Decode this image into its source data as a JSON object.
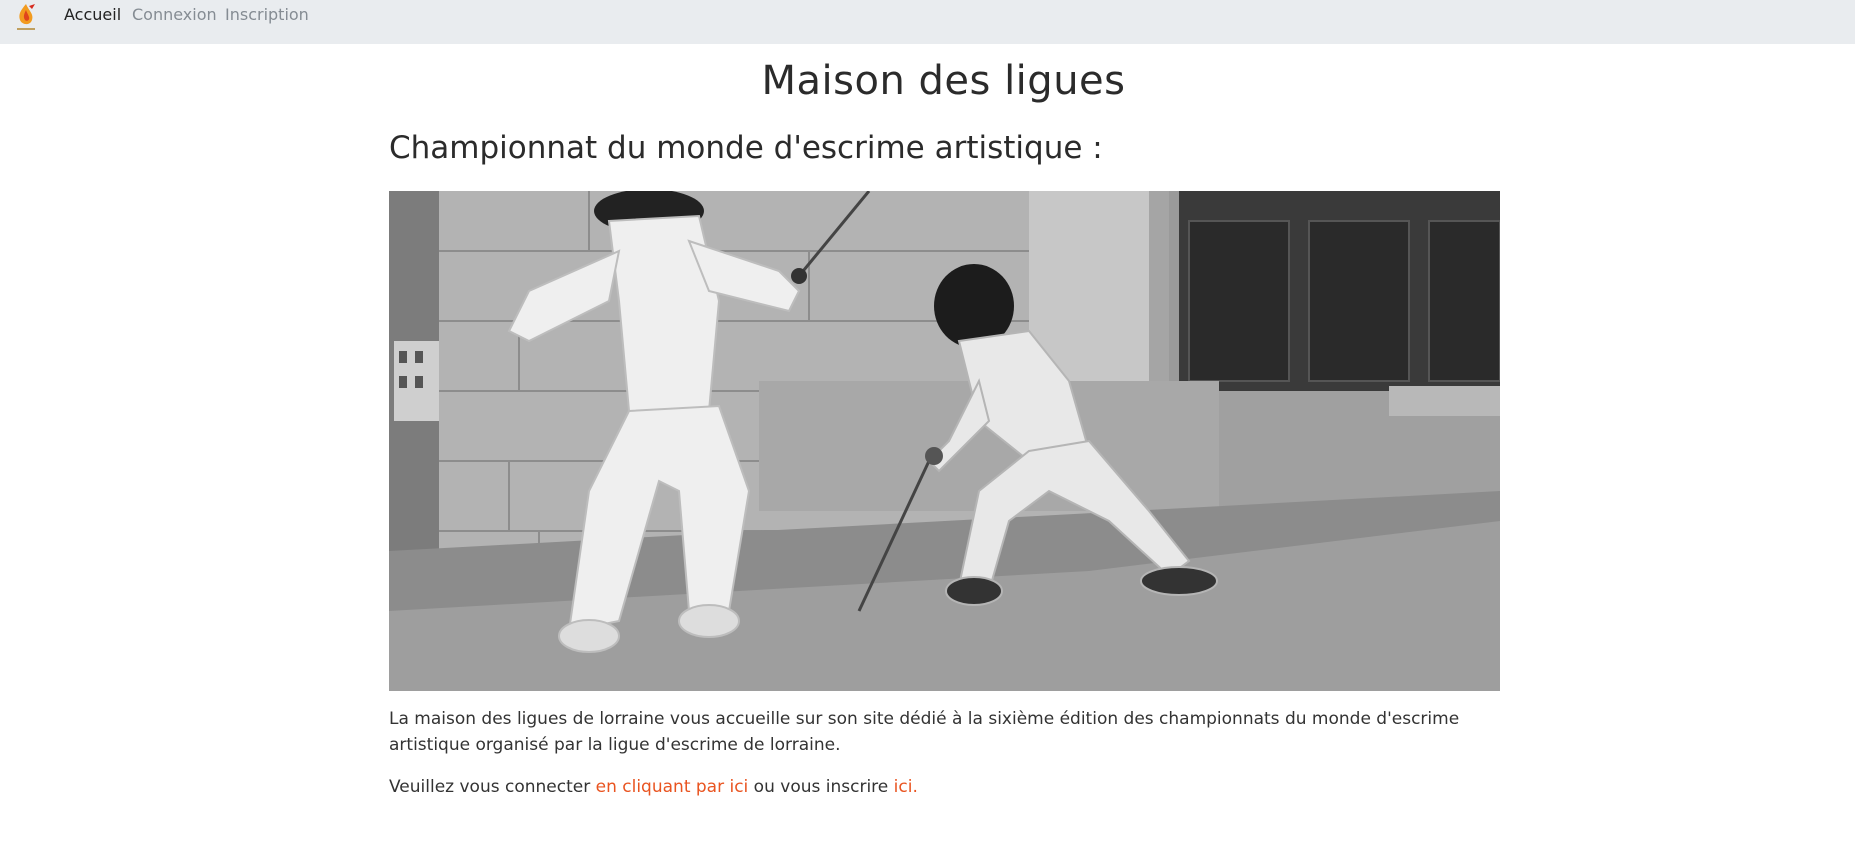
{
  "navbar": {
    "logo_icon": "league-flame-logo-icon",
    "links": [
      "Accueil",
      "Connexion",
      "Inscription"
    ],
    "active": "Accueil"
  },
  "page": {
    "title": "Maison des ligues",
    "section_title": "Championnat du monde d'escrime artistique :",
    "hero_image": "fencing-photo-black-and-white",
    "intro": "La maison des ligues de lorraine vous accueille sur son site dédié à la sixième édition des championnats du monde d'escrime artistique organisé par la ligue d'escrime de lorraine.",
    "login_prefix": "Veuillez vous connecter ",
    "login_link": "en cliquant par ici",
    "register_prefix": " ou vous inscrire ",
    "register_link": "ici."
  },
  "colors": {
    "navbar_bg": "#e9ecef",
    "link_accent": "#e95420",
    "nav_inactive": "#858c93"
  }
}
